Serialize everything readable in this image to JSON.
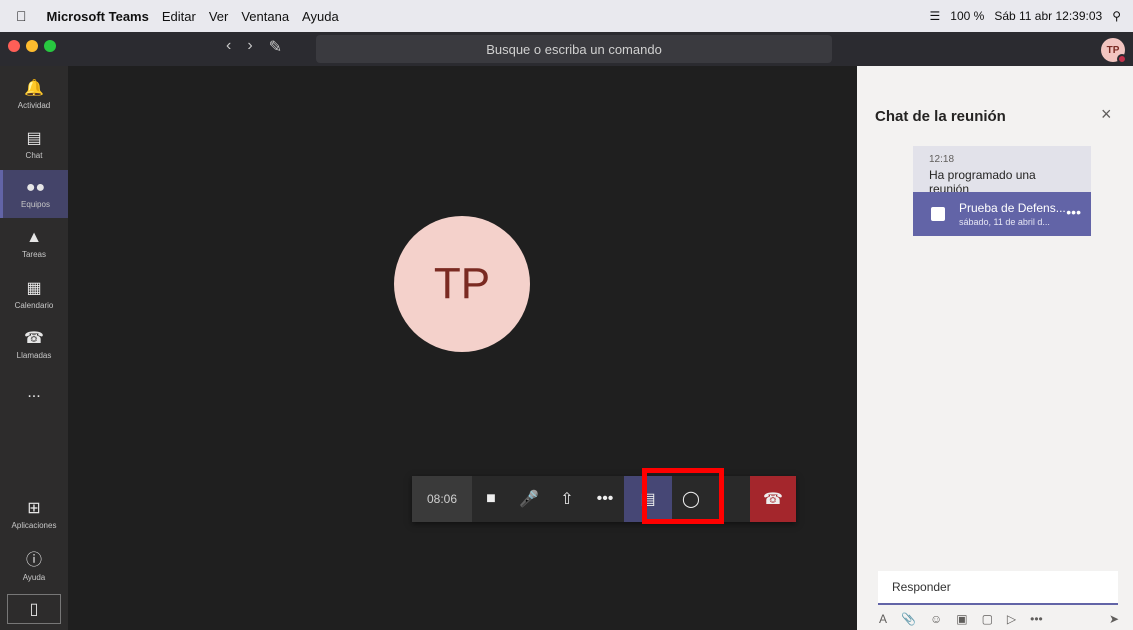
{
  "menubar": {
    "app": "Microsoft Teams",
    "items": [
      "Editar",
      "Ver",
      "Ventana",
      "Ayuda"
    ],
    "battery": "100 %",
    "datetime": "Sáb 11 abr 12:39:03"
  },
  "search": {
    "placeholder": "Busque o escriba un comando"
  },
  "user": {
    "initials": "TP"
  },
  "rail": [
    {
      "label": "Actividad",
      "icon": "bell-icon"
    },
    {
      "label": "Chat",
      "icon": "chat-icon"
    },
    {
      "label": "Equipos",
      "icon": "teams-icon"
    },
    {
      "label": "Tareas",
      "icon": "tasks-icon"
    },
    {
      "label": "Calendario",
      "icon": "calendar-icon"
    },
    {
      "label": "Llamadas",
      "icon": "phone-icon"
    },
    {
      "label": "...",
      "icon": "more-icon"
    },
    {
      "label": "Aplicaciones",
      "icon": "apps-icon"
    },
    {
      "label": "Ayuda",
      "icon": "help-icon"
    }
  ],
  "call": {
    "timer": "08:06"
  },
  "chat": {
    "title": "Chat de la reunión",
    "message": {
      "time": "12:18",
      "text": "Ha programado una reunión"
    },
    "card": {
      "title": "Prueba de Defens...",
      "subtitle": "sábado, 11 de abril d..."
    },
    "reply_placeholder": "Responder"
  }
}
